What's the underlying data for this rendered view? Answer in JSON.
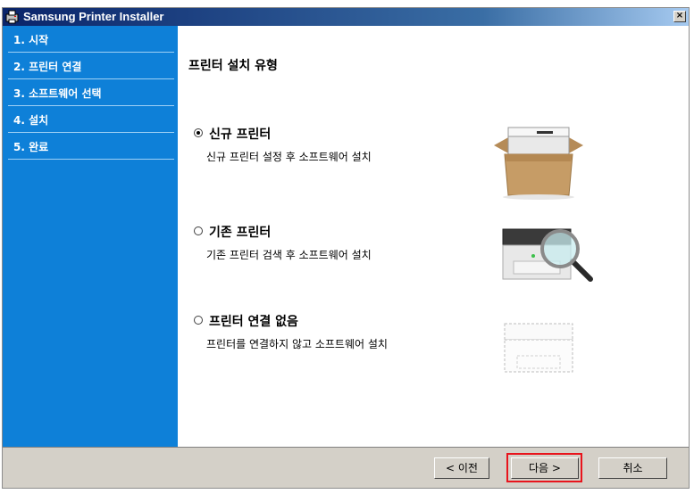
{
  "window": {
    "title": "Samsung Printer Installer",
    "close_glyph": "×"
  },
  "sidebar": {
    "steps": [
      {
        "label": "1. 시작"
      },
      {
        "label": "2. 프린터 연결"
      },
      {
        "label": "3. 소프트웨어 선택"
      },
      {
        "label": "4. 설치"
      },
      {
        "label": "5. 완료"
      }
    ]
  },
  "main": {
    "title": "프린터 설치 유형",
    "options": [
      {
        "label": "신규 프린터",
        "description": "신규 프린터 설정 후 소프트웨어 설치",
        "selected": true,
        "icon": "printer-in-box-icon"
      },
      {
        "label": "기존 프린터",
        "description": "기존 프린터 검색 후 소프트웨어 설치",
        "selected": false,
        "icon": "printer-search-icon"
      },
      {
        "label": "프린터 연결 없음",
        "description": "프린터를 연결하지 않고 소프트웨어 설치",
        "selected": false,
        "icon": "printer-outline-icon"
      }
    ]
  },
  "footer": {
    "prev_label": "< 이전",
    "next_label": "다음 >",
    "cancel_label": "취소"
  },
  "colors": {
    "sidebar": "#0e80d8",
    "highlight": "#e8141c"
  }
}
